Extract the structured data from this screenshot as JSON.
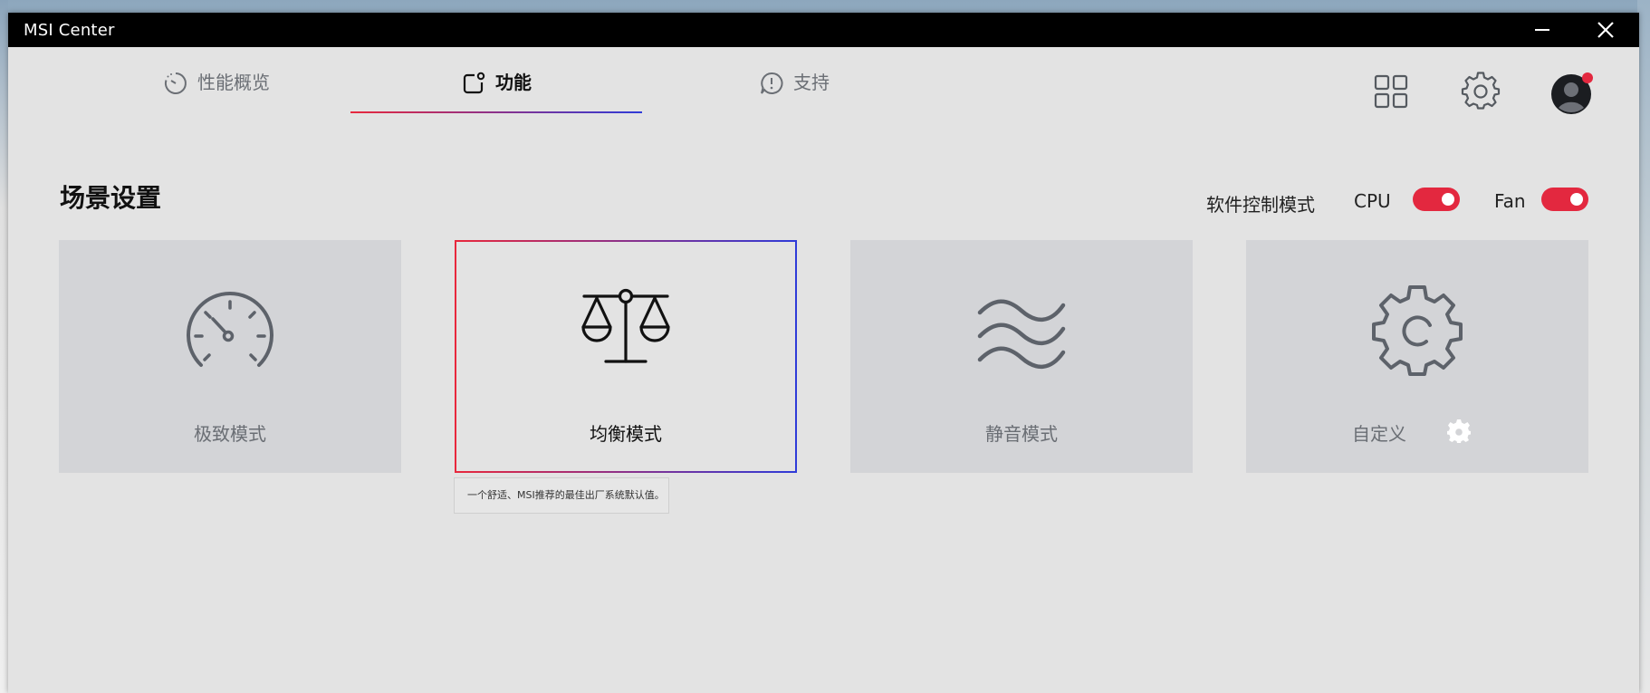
{
  "window": {
    "title": "MSI Center"
  },
  "nav": {
    "tabs": [
      {
        "label": "性能概览",
        "icon": "gauge-clock-icon"
      },
      {
        "label": "功能",
        "icon": "feature-square-icon",
        "active": true
      },
      {
        "label": "支持",
        "icon": "chat-alert-icon"
      }
    ]
  },
  "header_icons": [
    "apps-grid-icon",
    "settings-gear-icon",
    "user-avatar-icon"
  ],
  "section": {
    "title": "场景设置"
  },
  "controls": {
    "mode_label": "软件控制模式",
    "cpu_label": "CPU",
    "fan_label": "Fan",
    "cpu_on": true,
    "fan_on": true
  },
  "scenarios": [
    {
      "label": "极致模式",
      "icon": "speedometer-icon"
    },
    {
      "label": "均衡模式",
      "icon": "balance-scale-icon",
      "selected": true
    },
    {
      "label": "静音模式",
      "icon": "wave-lines-icon"
    },
    {
      "label": "自定义",
      "icon": "custom-gear-icon"
    }
  ],
  "tooltip": {
    "text": "一个舒适、MSI推荐的最佳出厂系统默认值。"
  },
  "colors": {
    "accent_red": "#e3283f",
    "accent_blue": "#2f3bd8",
    "card_bg": "#d3d4d7",
    "window_bg": "#e3e3e3"
  }
}
